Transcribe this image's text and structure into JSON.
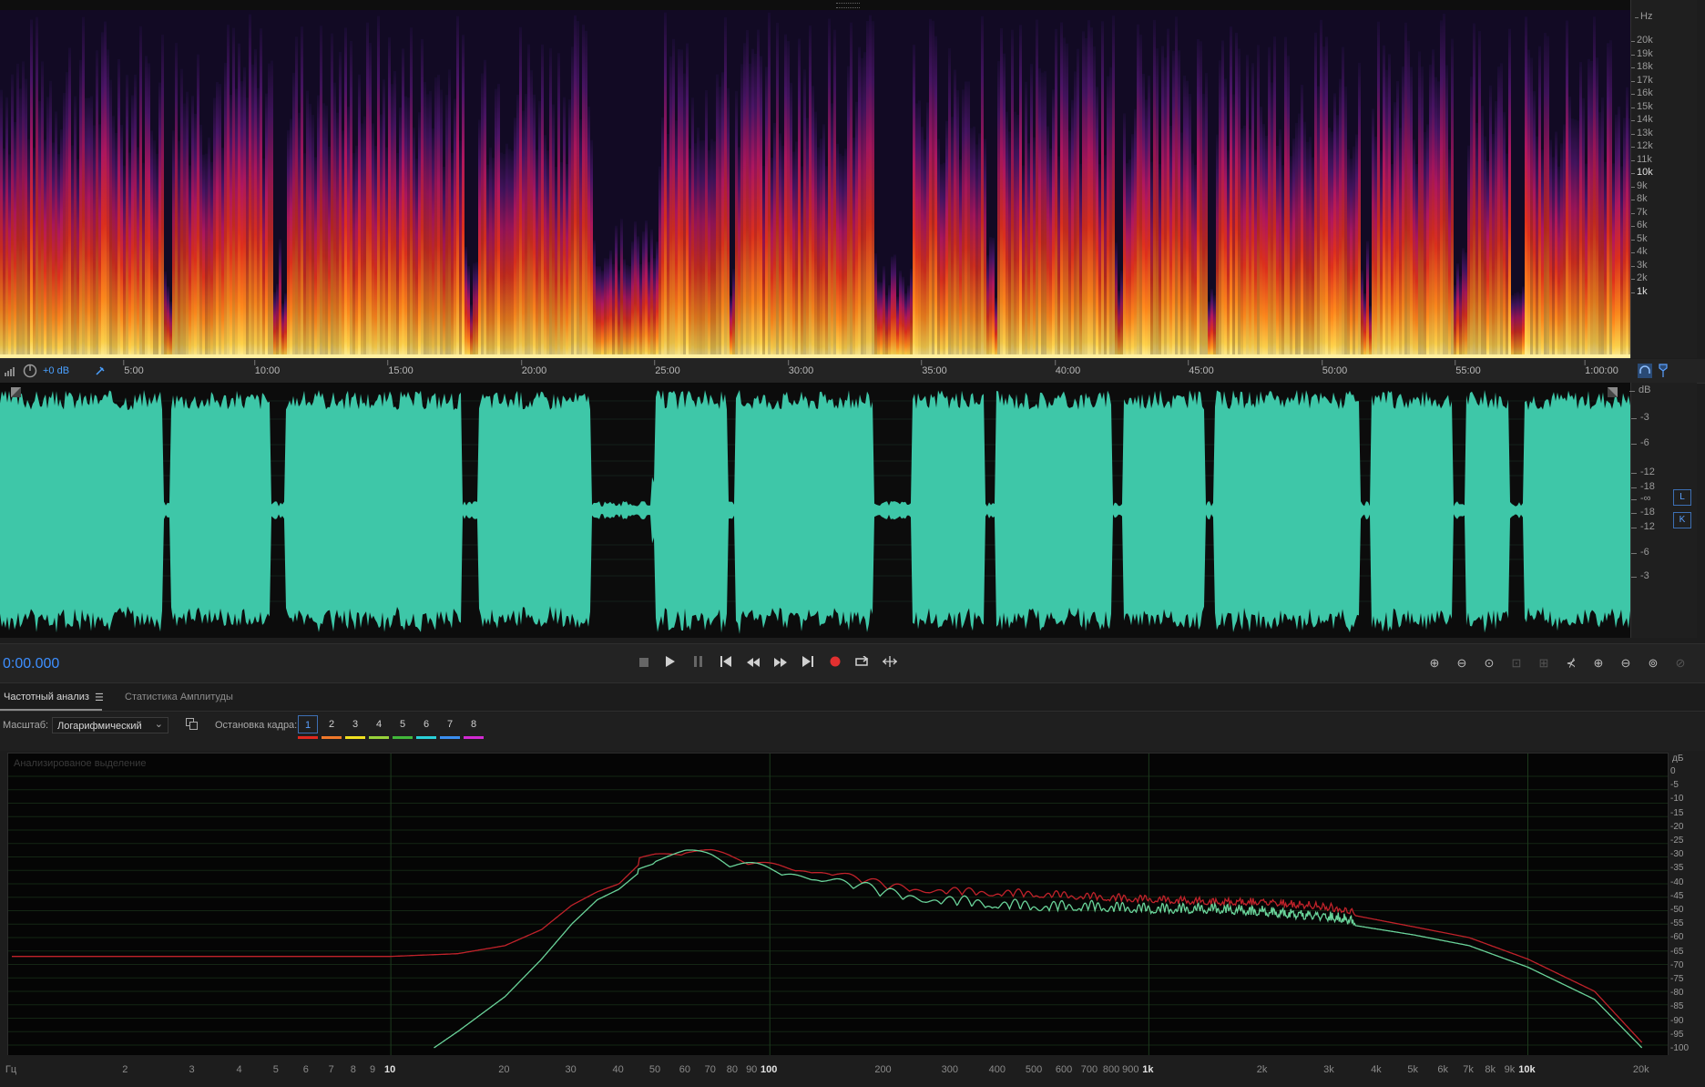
{
  "spectral": {
    "hz_label": "Hz",
    "hz_ticks": [
      {
        "label": "20k",
        "bold": false
      },
      {
        "label": "19k",
        "bold": false
      },
      {
        "label": "18k",
        "bold": false
      },
      {
        "label": "17k",
        "bold": false
      },
      {
        "label": "16k",
        "bold": false
      },
      {
        "label": "15k",
        "bold": false
      },
      {
        "label": "14k",
        "bold": false
      },
      {
        "label": "13k",
        "bold": false
      },
      {
        "label": "12k",
        "bold": false
      },
      {
        "label": "11k",
        "bold": false
      },
      {
        "label": "10k",
        "bold": true
      },
      {
        "label": "9k",
        "bold": false
      },
      {
        "label": "8k",
        "bold": false
      },
      {
        "label": "7k",
        "bold": false
      },
      {
        "label": "6k",
        "bold": false
      },
      {
        "label": "5k",
        "bold": false
      },
      {
        "label": "4k",
        "bold": false
      },
      {
        "label": "3k",
        "bold": false
      },
      {
        "label": "2k",
        "bold": false
      },
      {
        "label": "1k",
        "bold": true
      }
    ]
  },
  "ruler": {
    "volume": "+0 dB",
    "ticks": [
      "5:00",
      "10:00",
      "15:00",
      "20:00",
      "25:00",
      "30:00",
      "35:00",
      "40:00",
      "45:00",
      "50:00",
      "55:00",
      "1:00:00"
    ]
  },
  "waveform": {
    "db_label": "dB",
    "db_ticks": [
      "-3",
      "-6",
      "-12",
      "-18",
      "-∞",
      "-18",
      "-12",
      "-6",
      "-3"
    ],
    "channels": [
      "L",
      "K"
    ],
    "color": "#3ec7a8"
  },
  "transport": {
    "time": "0:00.000"
  },
  "panel": {
    "tab_freq": "Частотный анализ",
    "tab_amp": "Статистика Амплитуды",
    "scale_label": "Масштаб:",
    "scale_value": "Логарифмический",
    "hold_label": "Остановка кадра:",
    "hold_slots": [
      {
        "label": "1",
        "color": "#e0281e"
      },
      {
        "label": "2",
        "color": "#f0782a"
      },
      {
        "label": "3",
        "color": "#f0e020"
      },
      {
        "label": "4",
        "color": "#98d23a"
      },
      {
        "label": "5",
        "color": "#42b83a"
      },
      {
        "label": "6",
        "color": "#2ad0d8"
      },
      {
        "label": "7",
        "color": "#3a8ef0"
      },
      {
        "label": "8",
        "color": "#d22ad2"
      }
    ]
  },
  "analysis": {
    "title": "Анализированое выделение",
    "db_unit": "дБ",
    "db_ticks": [
      "0",
      "-5",
      "-10",
      "-15",
      "-20",
      "-25",
      "-30",
      "-35",
      "-40",
      "-45",
      "-50",
      "-55",
      "-60",
      "-65",
      "-70",
      "-75",
      "-80",
      "-85",
      "-90",
      "-95",
      "-100"
    ],
    "x_unit": "Гц",
    "x_ticks": [
      {
        "label": "2",
        "f": 2
      },
      {
        "label": "3",
        "f": 3
      },
      {
        "label": "4",
        "f": 4
      },
      {
        "label": "5",
        "f": 5
      },
      {
        "label": "6",
        "f": 6
      },
      {
        "label": "7",
        "f": 7
      },
      {
        "label": "8",
        "f": 8
      },
      {
        "label": "9",
        "f": 9
      },
      {
        "label": "10",
        "f": 10,
        "bold": true
      },
      {
        "label": "20",
        "f": 20
      },
      {
        "label": "30",
        "f": 30
      },
      {
        "label": "40",
        "f": 40
      },
      {
        "label": "50",
        "f": 50
      },
      {
        "label": "60",
        "f": 60
      },
      {
        "label": "70",
        "f": 70
      },
      {
        "label": "80",
        "f": 80
      },
      {
        "label": "90",
        "f": 90
      },
      {
        "label": "100",
        "f": 100,
        "bold": true
      },
      {
        "label": "200",
        "f": 200
      },
      {
        "label": "300",
        "f": 300
      },
      {
        "label": "400",
        "f": 400
      },
      {
        "label": "500",
        "f": 500
      },
      {
        "label": "600",
        "f": 600
      },
      {
        "label": "700",
        "f": 700
      },
      {
        "label": "800",
        "f": 800
      },
      {
        "label": "900",
        "f": 900
      },
      {
        "label": "1k",
        "f": 1000,
        "bold": true
      },
      {
        "label": "2k",
        "f": 2000
      },
      {
        "label": "3k",
        "f": 3000
      },
      {
        "label": "4k",
        "f": 4000
      },
      {
        "label": "5k",
        "f": 5000
      },
      {
        "label": "6k",
        "f": 6000
      },
      {
        "label": "7k",
        "f": 7000
      },
      {
        "label": "8k",
        "f": 8000
      },
      {
        "label": "9k",
        "f": 9000
      },
      {
        "label": "10k",
        "f": 10000,
        "bold": true
      },
      {
        "label": "20k",
        "f": 20000
      }
    ]
  },
  "chart_data": {
    "type": "line",
    "xscale": "log",
    "xlim": [
      1,
      23000
    ],
    "ylim": [
      -102,
      2
    ],
    "grid": true,
    "series": [
      {
        "color": "#c0222a",
        "x": [
          1,
          5,
          10,
          15,
          20,
          25,
          30,
          35,
          40,
          45,
          50,
          60,
          70,
          80,
          100,
          150,
          200,
          300,
          500,
          700,
          1000,
          1500,
          2000,
          3000,
          5000,
          7000,
          10000,
          15000,
          20000
        ],
        "y": [
          -67,
          -67,
          -67,
          -66,
          -63,
          -57,
          -48,
          -43,
          -40,
          -33,
          -31,
          -29,
          -30,
          -32,
          -34,
          -37,
          -42,
          -44,
          -45,
          -46,
          -47,
          -48,
          -48,
          -50,
          -56,
          -60,
          -68,
          -80,
          -99
        ]
      },
      {
        "color": "#6ad49a",
        "x": [
          13,
          15,
          20,
          25,
          30,
          35,
          40,
          45,
          50,
          60,
          70,
          80,
          100,
          150,
          200,
          300,
          500,
          700,
          1000,
          1500,
          2000,
          3000,
          5000,
          7000,
          10000,
          15000,
          20000
        ],
        "y": [
          -101,
          -95,
          -82,
          -68,
          -55,
          -46,
          -42,
          -36,
          -32,
          -31,
          -32,
          -34,
          -36,
          -40,
          -45,
          -48,
          -50,
          -50,
          -51,
          -51,
          -52,
          -54,
          -59,
          -63,
          -71,
          -83,
          -101
        ]
      }
    ]
  }
}
